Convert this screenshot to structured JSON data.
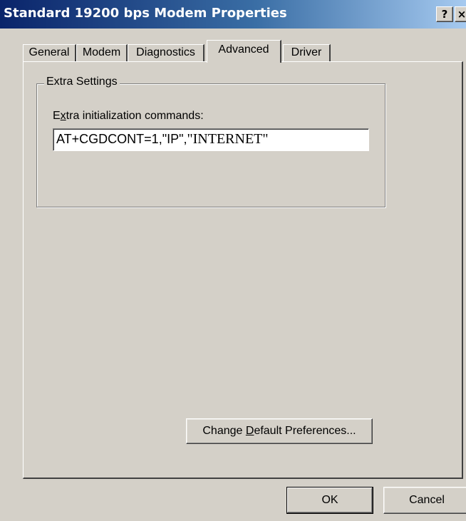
{
  "window": {
    "title": "Standard 19200 bps Modem Properties",
    "help_button": "?",
    "close_button": "×"
  },
  "tabs": [
    {
      "label": "General"
    },
    {
      "label": "Modem"
    },
    {
      "label": "Diagnostics"
    },
    {
      "label": "Advanced",
      "active": true
    },
    {
      "label": "Driver"
    }
  ],
  "extra_settings": {
    "group_label": "Extra Settings",
    "field_label_pre": "E",
    "field_label_mnemonic": "x",
    "field_label_post": "tra initialization commands:",
    "value_part1": "AT+CGDCONT=1,\"IP\",",
    "value_part2": "\"INTERNET\""
  },
  "change_defaults_button": {
    "pre": "Change ",
    "mnemonic": "D",
    "post": "efault Preferences..."
  },
  "footer": {
    "ok_label": "OK",
    "cancel_label": "Cancel"
  },
  "colors": {
    "face": "#d4d0c8",
    "title_start": "#0a246a",
    "title_end": "#a6caf0"
  }
}
